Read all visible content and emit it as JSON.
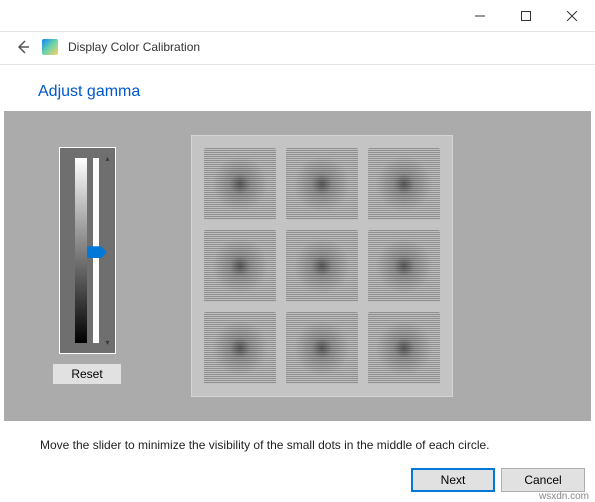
{
  "window": {
    "title": "Display Color Calibration"
  },
  "step": {
    "title": "Adjust gamma",
    "instruction": "Move the slider to minimize the visibility of the small dots in the middle of each circle."
  },
  "slider": {
    "reset_label": "Reset"
  },
  "footer": {
    "next_label": "Next",
    "cancel_label": "Cancel"
  },
  "watermark": "wsxdn.com"
}
